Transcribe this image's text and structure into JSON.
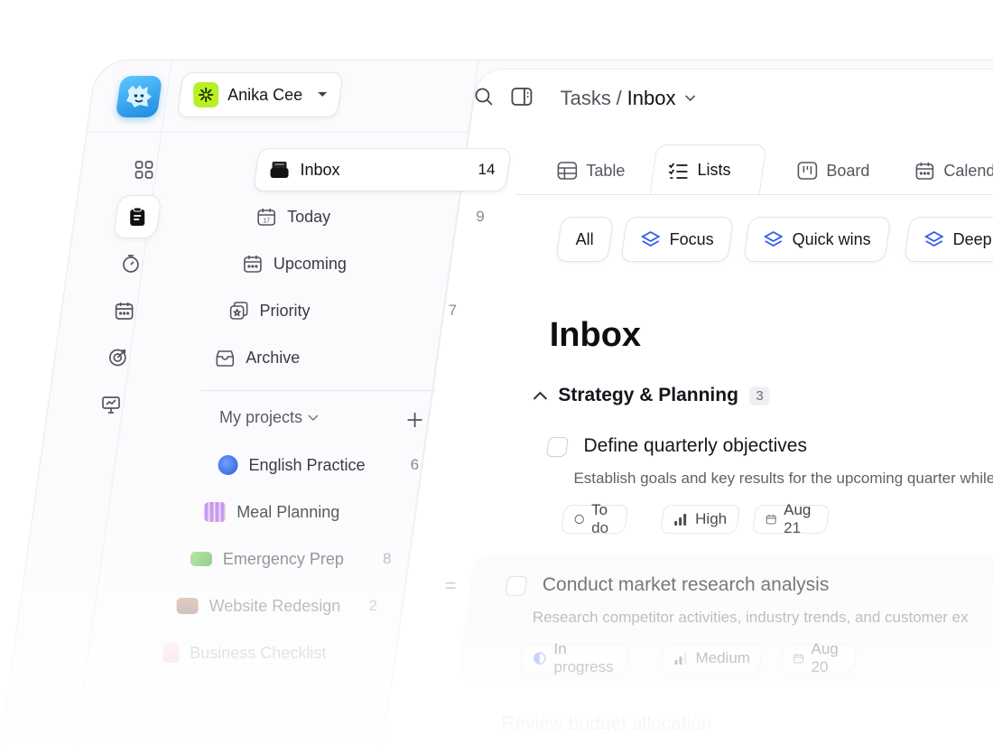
{
  "workspace": {
    "name": "Anika Cee"
  },
  "breadcrumb": {
    "parent": "Tasks",
    "separator": "/",
    "current": "Inbox"
  },
  "sidebar": {
    "items": [
      {
        "label": "Inbox",
        "count": "14",
        "icon": "inbox-icon",
        "active": true
      },
      {
        "label": "Today",
        "count": "9",
        "icon": "calendar-day-icon"
      },
      {
        "label": "Upcoming",
        "count": "",
        "icon": "calendar-icon"
      },
      {
        "label": "Priority",
        "count": "7",
        "icon": "priority-icon"
      },
      {
        "label": "Archive",
        "count": "",
        "icon": "archive-icon"
      }
    ],
    "projects_title": "My projects",
    "projects": [
      {
        "label": "English Practice",
        "count": "6",
        "icon": "graduation-cap-icon",
        "color": "#3a6df0"
      },
      {
        "label": "Meal Planning",
        "count": "",
        "icon": "calendar-grid-icon",
        "color": "#b58cf2"
      },
      {
        "label": "Emergency Prep",
        "count": "8",
        "icon": "cash-icon",
        "color": "#4caf50"
      },
      {
        "label": "Website Redesign",
        "count": "2",
        "icon": "briefcase-icon",
        "color": "#8b5a3c"
      },
      {
        "label": "Business Checklist",
        "count": "",
        "icon": "checklist-icon",
        "color": "#f06aa8"
      }
    ]
  },
  "tabs": [
    {
      "label": "Table",
      "icon": "table-icon"
    },
    {
      "label": "Lists",
      "icon": "list-check-icon",
      "active": true
    },
    {
      "label": "Board",
      "icon": "board-icon"
    },
    {
      "label": "Calendar",
      "icon": "calendar-icon"
    }
  ],
  "filters": [
    {
      "label": "All"
    },
    {
      "label": "Focus",
      "icon": "layers-icon"
    },
    {
      "label": "Quick wins",
      "icon": "layers-icon"
    },
    {
      "label": "Deep work",
      "icon": "layers-icon"
    }
  ],
  "main": {
    "title": "Inbox",
    "group": {
      "title": "Strategy & Planning",
      "count": "3"
    },
    "tasks": [
      {
        "title": "Define quarterly objectives",
        "description": "Establish goals and key results for the upcoming quarter while",
        "status": "To do",
        "priority": "High",
        "due": "Aug 21"
      },
      {
        "title": "Conduct market research analysis",
        "description": "Research competitor activities, industry trends, and customer ex",
        "status": "In progress",
        "priority": "Medium",
        "due": "Aug 20"
      },
      {
        "title": "Review budget allocation"
      }
    ]
  },
  "colors": {
    "accent": "#2f5bea",
    "workspace": "#b8f026",
    "logo": "#1f8be0"
  }
}
